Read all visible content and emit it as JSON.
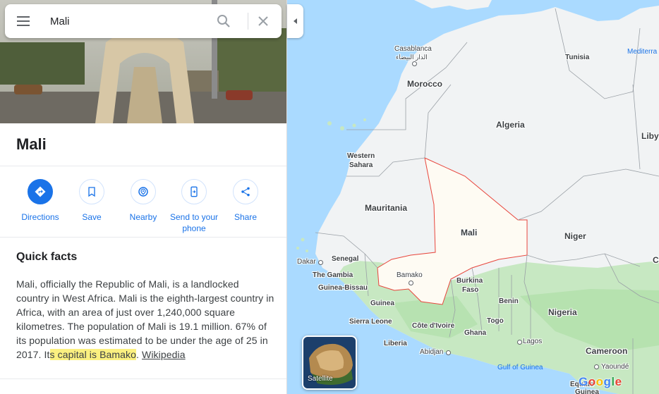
{
  "search": {
    "value": "Mali"
  },
  "place": {
    "title": "Mali"
  },
  "actions": [
    {
      "label": "Directions"
    },
    {
      "label": "Save"
    },
    {
      "label": "Nearby"
    },
    {
      "label": "Send to your phone"
    },
    {
      "label": "Share"
    }
  ],
  "quick_facts": {
    "heading": "Quick facts",
    "text_before": "Mali, officially the Republic of Mali, is a landlocked country in West Africa. Mali is the eighth-largest country in Africa, with an area of just over 1,240,000 square kilometres. The population of Mali is 19.1 million. 67% of its population was estimated to be under the age of 25 in 2017. It",
    "text_highlight": "s capital is Bamako",
    "text_after": ". ",
    "source_link": "Wikipedia"
  },
  "map": {
    "countries": {
      "morocco": "Morocco",
      "algeria": "Algeria",
      "tunisia": "Tunisia",
      "libya": "Liby",
      "western_sahara": [
        "Western",
        "Sahara"
      ],
      "mauritania": "Mauritania",
      "mali": "Mali",
      "niger": "Niger",
      "senegal": "Senegal",
      "the_gambia": "The Gambia",
      "guinea_bissau": "Guinea-Bissau",
      "guinea": "Guinea",
      "sierra_leone": "Sierra Leone",
      "liberia": "Liberia",
      "cote_divoire": "Côte d'Ivoire",
      "burkina_faso": [
        "Burkina",
        "Faso"
      ],
      "ghana": "Ghana",
      "togo": "Togo",
      "benin": "Benin",
      "nigeria": "Nigeria",
      "cameroon": "Cameroon",
      "chad_partial": "C",
      "equatorial_guinea": "Equato",
      "guinea_partial": "Guinea"
    },
    "cities": {
      "casablanca": "Casablanca",
      "casablanca_ar": "الدار البيضاء",
      "dakar": "Dakar",
      "bamako": "Bamako",
      "abidjan": "Abidjan",
      "lagos": "Lagos",
      "yaounde": "Yaoundé"
    },
    "water": {
      "mediterranean": "Mediterra",
      "gulf_of_guinea": "Gulf of Guinea"
    },
    "colors": {
      "ocean": "#aadaff",
      "desert": "#f1f3f4",
      "selected_fill": "#fefbf3",
      "selected_border": "#e8453c",
      "vegetation": "#c7e8c2",
      "border": "#9aa0a6"
    },
    "layer_button": {
      "label": "Satellite"
    },
    "logo": [
      "G",
      "o",
      "o",
      "g",
      "l",
      "e"
    ]
  },
  "icons": {
    "menu": "menu-icon",
    "search": "search-icon",
    "clear": "close-icon",
    "collapse": "chevron-left-icon",
    "directions": "directions-icon",
    "save": "bookmark-icon",
    "nearby": "nearby-icon",
    "send": "phone-icon",
    "share": "share-icon"
  }
}
